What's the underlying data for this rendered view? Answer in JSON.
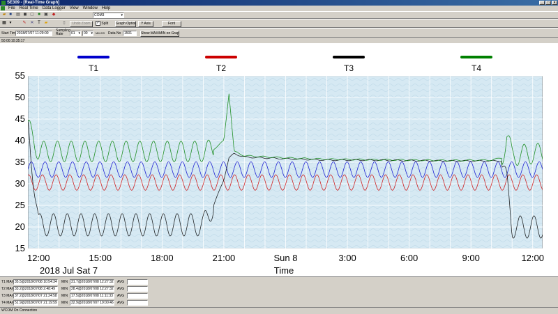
{
  "window": {
    "app": "SE309",
    "title": "[Real-Time Graph]"
  },
  "menu": [
    "File",
    "Real Time",
    "Data Logger",
    "View",
    "Window",
    "Help"
  ],
  "toolbar1": {
    "port": "COM3"
  },
  "toolbar2": {
    "undo_zoom": "Undo Zoom",
    "split": "Split",
    "graph_option": "Graph Option",
    "y_axis": "Y Axis",
    "font": "Font"
  },
  "toolbar3": {
    "start_time_label": "Start Time",
    "start_time_value": "2018/07/07 11:29:00",
    "sampling_rate_label": "Sampling Rate",
    "rate_min": "01",
    "rate_sec": "00",
    "rate_unit": "MM:SS",
    "data_no_label": "Data No",
    "data_no_value": "1501",
    "show_maxmin": "Show MAX/MIN on Graph"
  },
  "elapsed": "50:00:10:35:17",
  "legend": [
    {
      "name": "T1",
      "color": "#0000cc"
    },
    {
      "name": "T2",
      "color": "#cc0000"
    },
    {
      "name": "T3",
      "color": "#000000"
    },
    {
      "name": "T4",
      "color": "#008000"
    }
  ],
  "axis": {
    "y_ticks": [
      "55",
      "50",
      "45",
      "40",
      "35",
      "30",
      "25",
      "20",
      "15"
    ],
    "x_ticks": [
      "12:00",
      "15:00",
      "18:00",
      "21:00",
      "Sun 8",
      "3:00",
      "6:00",
      "9:00",
      "12:00"
    ],
    "date_label": "2018 Jul Sat 7",
    "xlabel": "Time"
  },
  "chart_data": {
    "type": "line",
    "xlabel": "Time",
    "ylabel": "",
    "ylim": [
      15,
      55
    ],
    "x_start": "2018/07/07 11:29",
    "x_end": "2018/07/08 12:29",
    "x": [
      "11:30",
      "12:00",
      "14:00",
      "16:00",
      "18:00",
      "20:00",
      "20:30",
      "21:00",
      "21:15",
      "21:30",
      "22:00",
      "24:00",
      "2:00",
      "4:00",
      "6:00",
      "8:00",
      "10:00",
      "10:30",
      "10:45",
      "11:00",
      "12:00",
      "12:30"
    ],
    "grid": true,
    "series": [
      {
        "name": "T1",
        "color": "#0000cc",
        "values": [
          33.3,
          33.3,
          33.3,
          33.3,
          33.3,
          33.3,
          33.3,
          33.3,
          33.3,
          33.3,
          33.3,
          33.3,
          33.3,
          33.3,
          33.3,
          33.3,
          33.3,
          33.3,
          33.3,
          33.3,
          33.3,
          33.3
        ]
      },
      {
        "name": "T2",
        "color": "#cc0000",
        "values": [
          30.3,
          30.3,
          30.3,
          30.3,
          30.3,
          30.3,
          30.3,
          30.3,
          30.3,
          30.3,
          30.3,
          30.3,
          30.3,
          30.3,
          30.3,
          30.3,
          30.3,
          30.3,
          30.3,
          30.3,
          30.3,
          30.3
        ]
      },
      {
        "name": "T3",
        "color": "#000000",
        "values": [
          43,
          20.5,
          20.5,
          20.5,
          20.5,
          20.5,
          25,
          31,
          36,
          37,
          36.2,
          35.8,
          35.5,
          35.5,
          35.4,
          35.3,
          35.3,
          35.3,
          30,
          20,
          20,
          20
        ]
      },
      {
        "name": "T4",
        "color": "#008000",
        "values": [
          43,
          37.5,
          37.5,
          37.5,
          37.5,
          37.5,
          38,
          40,
          51,
          37.5,
          36.5,
          36,
          35.7,
          35.6,
          35.5,
          35.4,
          35.5,
          36,
          41,
          36.5,
          37,
          37
        ]
      }
    ]
  },
  "stats": [
    {
      "label": "T1 MAX",
      "max": "35.5@2018/07/08 10:54:34",
      "min_label": "MIN",
      "min": "31.7@2018/07/08 12:27:32",
      "avg_label": "AVG"
    },
    {
      "label": "T2 MAX",
      "max": "33.2@2018/07/08 2:48:49",
      "min_label": "MIN",
      "min": "28.4@2018/07/08 12:27:32",
      "avg_label": "AVG"
    },
    {
      "label": "T3 MAX",
      "max": "37.2@2018/07/07 21:24:58",
      "min_label": "MIN",
      "min": "17.5@2018/07/08 11:11:33",
      "avg_label": "AVG"
    },
    {
      "label": "T4 MAX",
      "max": "51.9@2018/07/07 21:19:59",
      "min_label": "MIN",
      "min": "32.9@2018/07/07 19:00:46",
      "avg_label": "AVG"
    }
  ],
  "status": "WCOM On Connection"
}
